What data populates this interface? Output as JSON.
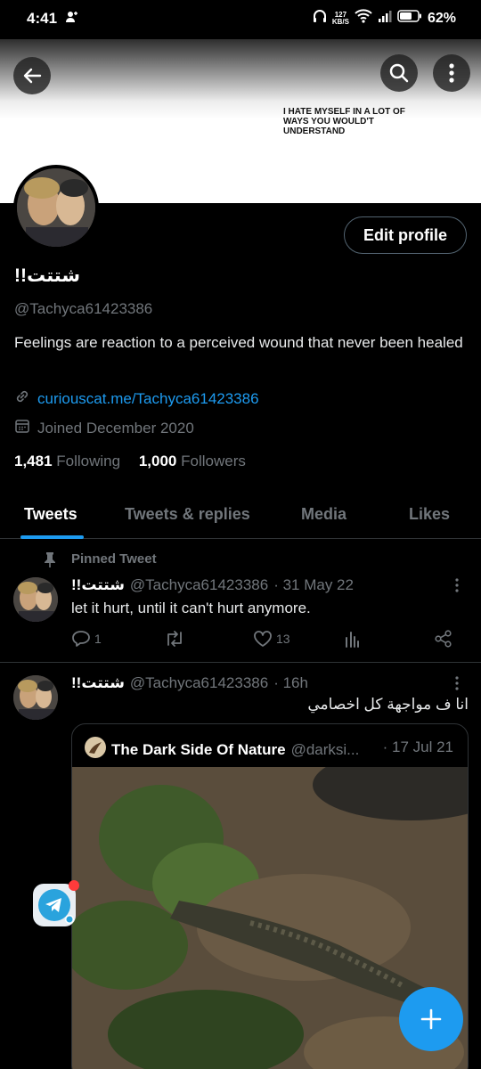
{
  "status_bar": {
    "time": "4:41",
    "net_speed_value": "127",
    "net_speed_unit": "KB/S",
    "battery": "62%"
  },
  "banner": {
    "quote": "I HATE MYSELF IN A LOT OF WAYS YOU WOULD'T UNDERSTAND"
  },
  "profile": {
    "edit_label": "Edit profile",
    "name": "شتتت!!",
    "handle": "@Tachyca61423386",
    "bio": "Feelings are reaction to a perceived wound that never been healed",
    "link": "curiouscat.me/Tachyca61423386",
    "joined": "Joined December 2020",
    "following_count": "1,481",
    "following_label": "Following",
    "followers_count": "1,000",
    "followers_label": "Followers"
  },
  "tabs": [
    {
      "label": "Tweets"
    },
    {
      "label": "Tweets & replies"
    },
    {
      "label": "Media"
    },
    {
      "label": "Likes"
    }
  ],
  "pinned_tweet": {
    "pinned_label": "Pinned Tweet",
    "name": "شتتت!!",
    "handle": "@Tachyca61423386",
    "date": "· 31 May 22",
    "text": "let it hurt, until it can't hurt anymore.",
    "replies": "1",
    "likes": "13"
  },
  "tweet2": {
    "name": "شتتت!!",
    "handle": "@Tachyca61423386",
    "date": "· 16h",
    "text": "انا ف مواجهة كل اخصامي",
    "quoted": {
      "name": "The Dark Side Of Nature",
      "handle": "@darksi...",
      "date": "· 17 Jul 21"
    }
  },
  "colors": {
    "accent": "#1d9bf0",
    "background": "#000000",
    "muted": "#71767b",
    "border": "#2f3336"
  }
}
